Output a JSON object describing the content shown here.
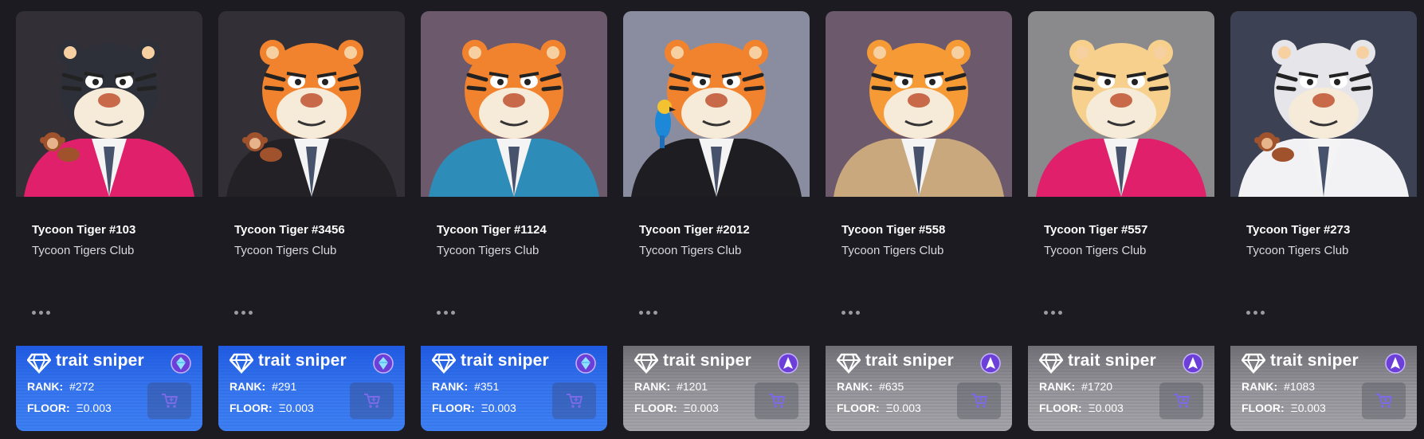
{
  "cards": [
    {
      "title": "Tycoon Tiger #103",
      "collection": "Tycoon Tigers Club",
      "rank_label": "RANK:",
      "rank": "#272",
      "floor_label": "FLOOR:",
      "floor": "Ξ0.003",
      "brand": "trait sniper",
      "tier": "blue",
      "bg": "#323036",
      "fur": "#2d3038",
      "jacket": "#e0206b",
      "pet": "monkey"
    },
    {
      "title": "Tycoon Tiger #3456",
      "collection": "Tycoon Tigers Club",
      "rank_label": "RANK:",
      "rank": "#291",
      "floor_label": "FLOOR:",
      "floor": "Ξ0.003",
      "brand": "trait sniper",
      "tier": "blue",
      "bg": "#323036",
      "fur": "#f2832e",
      "jacket": "#232126",
      "pet": "monkey"
    },
    {
      "title": "Tycoon Tiger #1124",
      "collection": "Tycoon Tigers Club",
      "rank_label": "RANK:",
      "rank": "#351",
      "floor_label": "FLOOR:",
      "floor": "Ξ0.003",
      "brand": "trait sniper",
      "tier": "blue",
      "bg": "#6c5a6c",
      "fur": "#f2832e",
      "jacket": "#2d8db8",
      "pet": "none"
    },
    {
      "title": "Tycoon Tiger #2012",
      "collection": "Tycoon Tigers Club",
      "rank_label": "RANK:",
      "rank": "#1201",
      "floor_label": "FLOOR:",
      "floor": "Ξ0.003",
      "brand": "trait sniper",
      "tier": "grey",
      "bg": "#8a8ca0",
      "fur": "#f2832e",
      "jacket": "#1e1e22",
      "pet": "parrot"
    },
    {
      "title": "Tycoon Tiger #558",
      "collection": "Tycoon Tigers Club",
      "rank_label": "RANK:",
      "rank": "#635",
      "floor_label": "FLOOR:",
      "floor": "Ξ0.003",
      "brand": "trait sniper",
      "tier": "grey",
      "bg": "#6c5a6c",
      "fur": "#f59a35",
      "jacket": "#c8a87c",
      "pet": "none"
    },
    {
      "title": "Tycoon Tiger #557",
      "collection": "Tycoon Tigers Club",
      "rank_label": "RANK:",
      "rank": "#1720",
      "floor_label": "FLOOR:",
      "floor": "Ξ0.003",
      "brand": "trait sniper",
      "tier": "grey",
      "bg": "#8a8a8c",
      "fur": "#f6d08c",
      "jacket": "#e0206b",
      "pet": "none"
    },
    {
      "title": "Tycoon Tiger #273",
      "collection": "Tycoon Tigers Club",
      "rank_label": "RANK:",
      "rank": "#1083",
      "floor_label": "FLOOR:",
      "floor": "Ξ0.003",
      "brand": "trait sniper",
      "tier": "grey",
      "bg": "#3c4254",
      "fur": "#e6e6ea",
      "jacket": "#f2f2f4",
      "pet": "monkey"
    }
  ]
}
